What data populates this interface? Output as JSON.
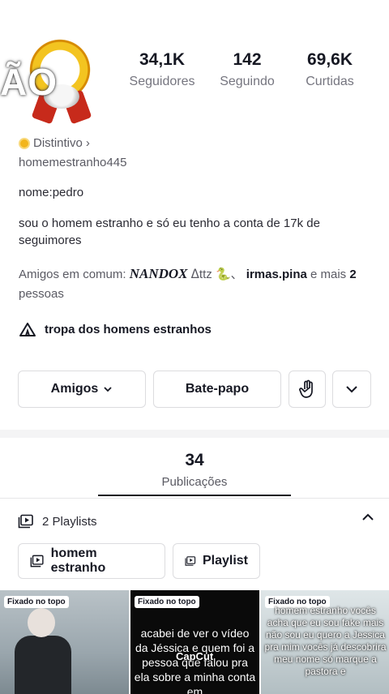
{
  "profile": {
    "avatar_overlay_text": "ÃO",
    "stats": [
      {
        "value": "34,1K",
        "label": "Seguidores"
      },
      {
        "value": "142",
        "label": "Seguindo"
      },
      {
        "value": "69,6K",
        "label": "Curtidas"
      }
    ],
    "badge_label": "Distintivo",
    "badge_chevron": "›",
    "handle": "homemestranho445",
    "nome": "nome:pedro",
    "bio": "sou o homem estranho e só eu tenho a conta de 17k de seguimores",
    "friends": {
      "prefix": "Amigos em comum: ",
      "friend1": "NANDOX",
      "friend1_suffix": " ᐃttz ",
      "sep": " 🐍、 ",
      "friend2": "irmas.pina",
      "mid": " e mais ",
      "count": "2",
      "suffix": " pessoas"
    },
    "group_name": "tropa dos homens estranhos"
  },
  "actions": {
    "amigos_label": "Amigos",
    "chat_label": "Bate-papo"
  },
  "tabs": {
    "publications_count": "34",
    "publications_label": "Publicações"
  },
  "playlists": {
    "header_label": "2 Playlists",
    "items": [
      {
        "label": "homem estranho"
      },
      {
        "label": "Playlist"
      }
    ]
  },
  "videos": [
    {
      "pin_label": "Fixado no topo",
      "caption": ""
    },
    {
      "pin_label": "Fixado no topo",
      "caption": "acabei de ver o vídeo da Jéssica e quem foi a pessoa que falou pra ela sobre a minha conta em",
      "watermark": "CapCut"
    },
    {
      "pin_label": "Fixado no topo",
      "caption": "homem estranho vocês acha que eu sou fake mais não sou eu quero a Jessica pra mim vocês já descobrira meu nome só marque a pastora e"
    }
  ],
  "colors": {
    "text_primary": "#161823",
    "text_secondary": "#5a5a63",
    "border": "#dcdcdf",
    "badge_gold": "#f2b51b"
  }
}
